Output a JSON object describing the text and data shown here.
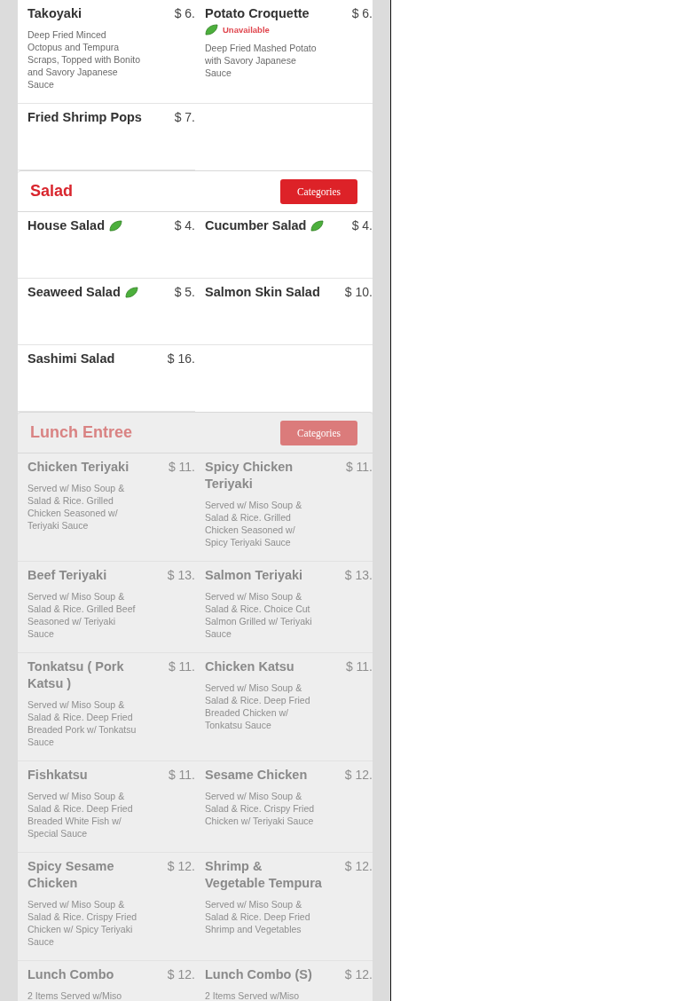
{
  "sections": [
    {
      "disabled": false,
      "items": [
        {
          "name": "Takoyaki",
          "price": "$ 6.",
          "vegetarian": false,
          "description": "Deep Fried Minced Octopus and Tempura Scraps, Topped with Bonito and Savory Japanese Sauce"
        },
        {
          "name": "Potato Croquette",
          "price": "$ 6.",
          "vegetarian": true,
          "status": "Unavailable",
          "description": "Deep Fried Mashed Potato with Savory Japanese Sauce"
        },
        {
          "name": "Fried Shrimp Pops",
          "price": "$ 7.",
          "vegetarian": false
        }
      ]
    },
    {
      "title": "Salad",
      "button": "Categories",
      "disabled": false,
      "items": [
        {
          "name": "House Salad",
          "price": "$ 4.",
          "vegetarian": true
        },
        {
          "name": "Cucumber Salad",
          "price": "$ 4.",
          "vegetarian": true
        },
        {
          "name": "Seaweed Salad",
          "price": "$ 5.",
          "vegetarian": true
        },
        {
          "name": "Salmon Skin Salad",
          "price": "$ 10.",
          "vegetarian": false
        },
        {
          "name": "Sashimi Salad",
          "price": "$ 16.",
          "vegetarian": false
        }
      ]
    },
    {
      "title": "Lunch Entree",
      "button": "Categories",
      "disabled": true,
      "items": [
        {
          "name": "Chicken Teriyaki",
          "price": "$ 11.",
          "vegetarian": false,
          "description": "Served w/ Miso Soup & Salad & Rice. Grilled Chicken Seasoned w/ Teriyaki Sauce"
        },
        {
          "name": "Spicy Chicken Teriyaki",
          "price": "$ 11.",
          "vegetarian": false,
          "description": "Served w/ Miso Soup & Salad & Rice. Grilled Chicken Seasoned w/ Spicy Teriyaki Sauce"
        },
        {
          "name": "Beef Teriyaki",
          "price": "$ 13.",
          "vegetarian": false,
          "description": "Served w/ Miso Soup & Salad & Rice. Grilled Beef Seasoned w/ Teriyaki Sauce"
        },
        {
          "name": "Salmon Teriyaki",
          "price": "$ 13.",
          "vegetarian": false,
          "description": "Served w/ Miso Soup & Salad & Rice. Choice Cut Salmon Grilled w/ Teriyaki Sauce"
        },
        {
          "name": "Tonkatsu ( Pork Katsu )",
          "price": "$ 11.",
          "vegetarian": false,
          "description": "Served w/ Miso Soup & Salad & Rice. Deep Fried Breaded Pork w/ Tonkatsu Sauce"
        },
        {
          "name": "Chicken Katsu",
          "price": "$ 11.",
          "vegetarian": false,
          "description": "Served w/ Miso Soup & Salad & Rice. Deep Fried Breaded Chicken w/ Tonkatsu Sauce"
        },
        {
          "name": "Fishkatsu",
          "price": "$ 11.",
          "vegetarian": false,
          "description": "Served w/ Miso Soup & Salad & Rice. Deep Fried Breaded White Fish w/ Special Sauce"
        },
        {
          "name": "Sesame Chicken",
          "price": "$ 12.",
          "vegetarian": false,
          "description": "Served w/ Miso Soup & Salad & Rice. Crispy Fried Chicken w/ Teriyaki Sauce"
        },
        {
          "name": "Spicy Sesame Chicken",
          "price": "$ 12.",
          "vegetarian": false,
          "description": "Served w/ Miso Soup & Salad & Rice. Crispy Fried Chicken w/ Spicy Teriyaki Sauce"
        },
        {
          "name": "Shrimp & Vegetable Tempura",
          "price": "$ 12.",
          "vegetarian": false,
          "description": "Served w/ Miso Soup & Salad & Rice. Deep Fried Shrimp and Vegetables"
        },
        {
          "name": "Lunch Combo",
          "price": "$ 12.",
          "vegetarian": false,
          "description": "2 Items Served w/Miso"
        },
        {
          "name": "Lunch Combo (S)",
          "price": "$ 12.",
          "vegetarian": false,
          "description": "2 Items Served w/Miso"
        }
      ]
    }
  ]
}
